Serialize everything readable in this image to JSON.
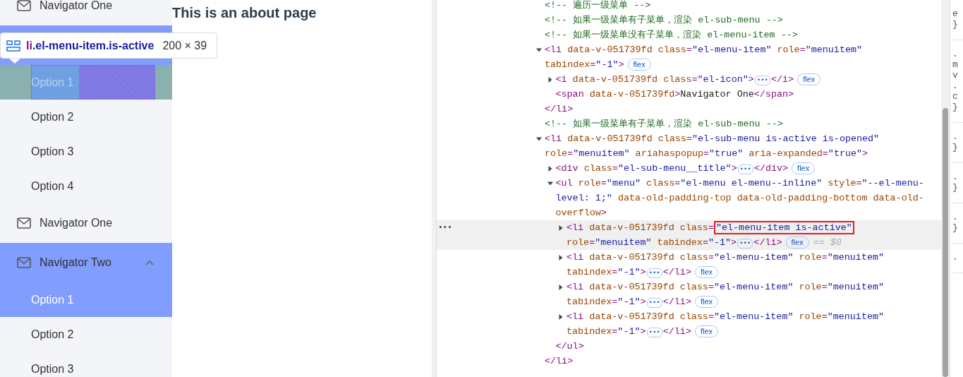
{
  "sidebar": {
    "items": [
      {
        "kind": "item",
        "label": "Navigator One",
        "selected": false
      },
      {
        "kind": "submenu",
        "active": true,
        "expanded": true,
        "children": [
          {
            "label": "Option 1",
            "selected": true,
            "inspected": true
          },
          {
            "label": "Option 2",
            "selected": false,
            "inspected": false
          },
          {
            "label": "Option 3",
            "selected": false,
            "inspected": false
          },
          {
            "label": "Option 4",
            "selected": false,
            "inspected": false
          }
        ]
      },
      {
        "kind": "item",
        "label": "Navigator One",
        "selected": false
      },
      {
        "kind": "submenu",
        "label": "Navigator Two",
        "active": true,
        "expanded": true,
        "children": [
          {
            "label": "Option 1",
            "selected": true,
            "inspected": false
          },
          {
            "label": "Option 2",
            "selected": false,
            "inspected": false
          },
          {
            "label": "Option 3",
            "selected": false,
            "inspected": false
          }
        ]
      }
    ]
  },
  "inspect_tooltip": {
    "tag": "li",
    "selector": ".el-menu-item.is-active",
    "size": "200 × 39"
  },
  "main": {
    "heading": "This is an about page"
  },
  "devtools": {
    "dom_tree": [
      {
        "kind": "comment",
        "text": "<!-- 遍历一级菜单 -->"
      },
      {
        "kind": "comment",
        "text": "<!-- 如果一级菜单有子菜单，渲染 el-sub-menu -->"
      },
      {
        "kind": "comment",
        "text": "<!-- 如果一级菜单没有子菜单，渲染 el-menu-item -->"
      },
      {
        "kind": "element",
        "expanded": true,
        "selected": false,
        "open": [
          {
            "kind": "tag",
            "text": "<li"
          },
          {
            "kind": "attr",
            "text": " data-v-051739fd"
          },
          {
            "kind": "attr",
            "text": " class"
          },
          {
            "kind": "tag",
            "text": "="
          },
          {
            "kind": "value",
            "text": "\"el-menu-item\""
          },
          {
            "kind": "attr",
            "text": " role"
          },
          {
            "kind": "tag",
            "text": "="
          },
          {
            "kind": "value",
            "text": "\"menuitem\""
          },
          {
            "kind": "attr",
            "text": " tabindex"
          },
          {
            "kind": "tag",
            "text": "="
          },
          {
            "kind": "value",
            "text": "\"-1\""
          },
          {
            "kind": "tag",
            "text": ">"
          },
          {
            "kind": "flex",
            "text": "flex"
          }
        ],
        "children": [
          {
            "kind": "element",
            "expanded": false,
            "selected": false,
            "open": [
              {
                "kind": "tag",
                "text": "<i"
              },
              {
                "kind": "attr",
                "text": " data-v-051739fd"
              },
              {
                "kind": "attr",
                "text": " class"
              },
              {
                "kind": "tag",
                "text": "="
              },
              {
                "kind": "value",
                "text": "\"el-icon\""
              },
              {
                "kind": "tag",
                "text": ">"
              },
              {
                "kind": "ellipsis",
                "text": "•••"
              },
              {
                "kind": "tag",
                "text": "</i>"
              },
              {
                "kind": "flex",
                "text": "flex"
              }
            ]
          },
          {
            "kind": "element",
            "selected": false,
            "open": [
              {
                "kind": "tag",
                "text": "<span"
              },
              {
                "kind": "attr",
                "text": " data-v-051739fd"
              },
              {
                "kind": "tag",
                "text": ">"
              },
              {
                "kind": "text",
                "text": "Navigator One"
              },
              {
                "kind": "tag",
                "text": "</span>"
              }
            ]
          }
        ],
        "close": [
          {
            "kind": "tag",
            "text": "</li>"
          }
        ]
      },
      {
        "kind": "comment",
        "text": "<!-- 如果一级菜单有子菜单，渲染 el-sub-menu -->"
      },
      {
        "kind": "element",
        "expanded": true,
        "selected": false,
        "open": [
          {
            "kind": "tag",
            "text": "<li"
          },
          {
            "kind": "attr",
            "text": " data-v-051739fd"
          },
          {
            "kind": "attr",
            "text": " class"
          },
          {
            "kind": "tag",
            "text": "="
          },
          {
            "kind": "value",
            "text": "\"el-sub-menu is-active is-opened\""
          },
          {
            "kind": "attr",
            "text": " role"
          },
          {
            "kind": "tag",
            "text": "="
          },
          {
            "kind": "value",
            "text": "\"menuitem\""
          },
          {
            "kind": "attr",
            "text": " ariahaspopup"
          },
          {
            "kind": "tag",
            "text": "="
          },
          {
            "kind": "value",
            "text": "\"true\""
          },
          {
            "kind": "attr",
            "text": " aria-expanded"
          },
          {
            "kind": "tag",
            "text": "="
          },
          {
            "kind": "value",
            "text": "\"true\""
          },
          {
            "kind": "tag",
            "text": ">"
          }
        ],
        "children": [
          {
            "kind": "element",
            "expanded": false,
            "selected": false,
            "open": [
              {
                "kind": "tag",
                "text": "<div"
              },
              {
                "kind": "attr",
                "text": " class"
              },
              {
                "kind": "tag",
                "text": "="
              },
              {
                "kind": "value",
                "text": "\"el-sub-menu__title\""
              },
              {
                "kind": "tag",
                "text": ">"
              },
              {
                "kind": "ellipsis",
                "text": "•••"
              },
              {
                "kind": "tag",
                "text": "</div>"
              },
              {
                "kind": "flex",
                "text": "flex"
              }
            ]
          },
          {
            "kind": "element",
            "expanded": true,
            "selected": false,
            "open": [
              {
                "kind": "tag",
                "text": "<ul"
              },
              {
                "kind": "attr",
                "text": " role"
              },
              {
                "kind": "tag",
                "text": "="
              },
              {
                "kind": "value",
                "text": "\"menu\""
              },
              {
                "kind": "attr",
                "text": " class"
              },
              {
                "kind": "tag",
                "text": "="
              },
              {
                "kind": "value",
                "text": "\"el-menu el-menu--inline\""
              },
              {
                "kind": "attr",
                "text": " style"
              },
              {
                "kind": "tag",
                "text": "="
              },
              {
                "kind": "value",
                "text": "\"--el-menu-level: 1;\""
              },
              {
                "kind": "attr",
                "text": " data-old-padding-top"
              },
              {
                "kind": "attr",
                "text": " data-old-padding-bottom"
              },
              {
                "kind": "attr",
                "text": " data-old-overflow"
              },
              {
                "kind": "tag",
                "text": ">"
              }
            ],
            "children": [
              {
                "kind": "element",
                "expanded": false,
                "selected": true,
                "gutter": "•••",
                "open": [
                  {
                    "kind": "tag",
                    "text": "<li"
                  },
                  {
                    "kind": "attr",
                    "text": " data-v-051739fd"
                  },
                  {
                    "kind": "attr",
                    "text": " class"
                  },
                  {
                    "kind": "tag",
                    "text": "="
                  },
                  {
                    "kind": "boxed_value",
                    "text": "\"el-menu-item is-active\""
                  },
                  {
                    "kind": "attr",
                    "text": " role"
                  },
                  {
                    "kind": "tag",
                    "text": "="
                  },
                  {
                    "kind": "value",
                    "text": "\"menuitem\""
                  },
                  {
                    "kind": "attr",
                    "text": " tabindex"
                  },
                  {
                    "kind": "tag",
                    "text": "="
                  },
                  {
                    "kind": "value",
                    "text": "\"-1\""
                  },
                  {
                    "kind": "tag",
                    "text": ">"
                  },
                  {
                    "kind": "ellipsis",
                    "text": "•••"
                  },
                  {
                    "kind": "tag",
                    "text": "</li>"
                  },
                  {
                    "kind": "flex",
                    "text": "flex"
                  },
                  {
                    "kind": "ref",
                    "text": "== $0"
                  }
                ]
              },
              {
                "kind": "element",
                "expanded": false,
                "selected": false,
                "open": [
                  {
                    "kind": "tag",
                    "text": "<li"
                  },
                  {
                    "kind": "attr",
                    "text": " data-v-051739fd"
                  },
                  {
                    "kind": "attr",
                    "text": " class"
                  },
                  {
                    "kind": "tag",
                    "text": "="
                  },
                  {
                    "kind": "value",
                    "text": "\"el-menu-item\""
                  },
                  {
                    "kind": "attr",
                    "text": " role"
                  },
                  {
                    "kind": "tag",
                    "text": "="
                  },
                  {
                    "kind": "value",
                    "text": "\"menuitem\""
                  },
                  {
                    "kind": "attr",
                    "text": " tabindex"
                  },
                  {
                    "kind": "tag",
                    "text": "="
                  },
                  {
                    "kind": "value",
                    "text": "\"-1\""
                  },
                  {
                    "kind": "tag",
                    "text": ">"
                  },
                  {
                    "kind": "ellipsis",
                    "text": "•••"
                  },
                  {
                    "kind": "tag",
                    "text": "</li>"
                  },
                  {
                    "kind": "flex",
                    "text": "flex"
                  }
                ]
              },
              {
                "kind": "element",
                "expanded": false,
                "selected": false,
                "open": [
                  {
                    "kind": "tag",
                    "text": "<li"
                  },
                  {
                    "kind": "attr",
                    "text": " data-v-051739fd"
                  },
                  {
                    "kind": "attr",
                    "text": " class"
                  },
                  {
                    "kind": "tag",
                    "text": "="
                  },
                  {
                    "kind": "value",
                    "text": "\"el-menu-item\""
                  },
                  {
                    "kind": "attr",
                    "text": " role"
                  },
                  {
                    "kind": "tag",
                    "text": "="
                  },
                  {
                    "kind": "value",
                    "text": "\"menuitem\""
                  },
                  {
                    "kind": "attr",
                    "text": " tabindex"
                  },
                  {
                    "kind": "tag",
                    "text": "="
                  },
                  {
                    "kind": "value",
                    "text": "\"-1\""
                  },
                  {
                    "kind": "tag",
                    "text": ">"
                  },
                  {
                    "kind": "ellipsis",
                    "text": "•••"
                  },
                  {
                    "kind": "tag",
                    "text": "</li>"
                  },
                  {
                    "kind": "flex",
                    "text": "flex"
                  }
                ]
              },
              {
                "kind": "element",
                "expanded": false,
                "selected": false,
                "open": [
                  {
                    "kind": "tag",
                    "text": "<li"
                  },
                  {
                    "kind": "attr",
                    "text": " data-v-051739fd"
                  },
                  {
                    "kind": "attr",
                    "text": " class"
                  },
                  {
                    "kind": "tag",
                    "text": "="
                  },
                  {
                    "kind": "value",
                    "text": "\"el-menu-item\""
                  },
                  {
                    "kind": "attr",
                    "text": " role"
                  },
                  {
                    "kind": "tag",
                    "text": "="
                  },
                  {
                    "kind": "value",
                    "text": "\"menuitem\""
                  },
                  {
                    "kind": "attr",
                    "text": " tabindex"
                  },
                  {
                    "kind": "tag",
                    "text": "="
                  },
                  {
                    "kind": "value",
                    "text": "\"-1\""
                  },
                  {
                    "kind": "tag",
                    "text": ">"
                  },
                  {
                    "kind": "ellipsis",
                    "text": "•••"
                  },
                  {
                    "kind": "tag",
                    "text": "</li>"
                  },
                  {
                    "kind": "flex",
                    "text": "flex"
                  }
                ]
              }
            ],
            "close": [
              {
                "kind": "tag",
                "text": "</ul>"
              }
            ]
          }
        ],
        "close": [
          {
            "kind": "tag",
            "text": "</li>"
          }
        ]
      }
    ],
    "styles_panel": [
      [
        "e",
        "}"
      ],
      [
        ".",
        "m",
        "v",
        ".",
        "c",
        "}"
      ],
      [
        ".",
        "}"
      ],
      [
        ".",
        "}"
      ],
      [
        ".",
        "}"
      ],
      [
        "."
      ]
    ]
  }
}
